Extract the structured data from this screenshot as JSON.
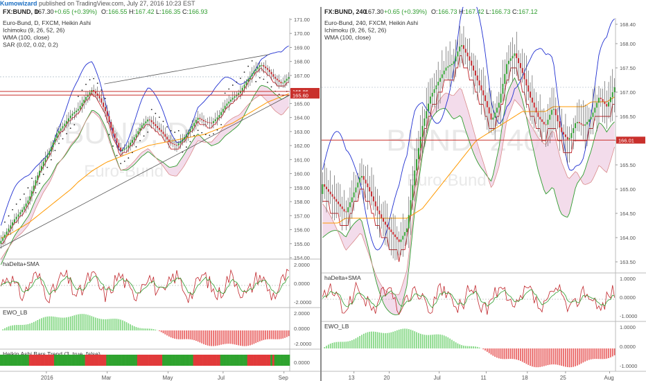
{
  "header": {
    "brand": "Kumowizard",
    "text": "published on TradingView.com, July 27, 2016 10:23 EST"
  },
  "colors": {
    "up": "#2e9c2e",
    "down": "#c0262b",
    "wma": "#ff9900",
    "tenkan": "#1f2fd1",
    "kijun": "#c0262b",
    "senkouA": "#2e9c2e",
    "cloud": "#f0d3e6",
    "trend": "#6a8f6a",
    "priceLine": "#c9302c",
    "ewoUp": "#7fd67f",
    "ewoDown": "#e85c5c",
    "sar": "#222222"
  },
  "charts": [
    {
      "id": "daily",
      "legend": {
        "symbol": "FX:BUND, D",
        "last": "167.30",
        "change": "+0.65 (+0.39%)",
        "o_label": "O:",
        "o": "166.55",
        "h_label": "H:",
        "h": "167.42",
        "l_label": "L:",
        "l": "166.35",
        "c_label": "C:",
        "c": "166.93"
      },
      "indicators": [
        "Euro-Bund, D, FXCM, Heikin Ashi",
        "Ichimoku (9, 26, 52, 26)",
        "WMA (100, close)",
        "SAR (0.02, 0.02, 0.2)"
      ],
      "watermark": {
        "big": "BUND, D",
        "small": "Euro-Bund"
      },
      "yTicks": [
        "171.00",
        "170.00",
        "169.00",
        "168.00",
        "167.00",
        "166.00",
        "165.00",
        "164.00",
        "163.00",
        "162.00",
        "161.00",
        "160.00",
        "159.00",
        "158.00",
        "157.00",
        "156.00",
        "155.00",
        "154.00"
      ],
      "yRange": [
        154,
        171
      ],
      "priceTags": [
        {
          "value": "165.86",
          "y": 165.86
        },
        {
          "value": "165.60",
          "y": 165.6
        }
      ],
      "xTicks": [
        {
          "label": "2016",
          "pos": 0.16
        },
        {
          "label": "Mar",
          "pos": 0.37
        },
        {
          "label": "May",
          "pos": 0.58
        },
        {
          "label": "Jul",
          "pos": 0.77
        },
        {
          "label": "Sep",
          "pos": 0.98
        }
      ],
      "sub": [
        {
          "title": "haDelta+SMA",
          "ticks": [
            "2.0000",
            "0.0000",
            "-2.0000"
          ]
        },
        {
          "title": "EWO_LB",
          "ticks": [
            "2.0000",
            "0.0000",
            "-2.0000"
          ]
        },
        {
          "title": "Heikin Ashi Bars Trend (3, true, false)",
          "ticks": [
            "0.0000"
          ]
        }
      ]
    },
    {
      "id": "h4",
      "legend": {
        "symbol": "FX:BUND, 240",
        "last": "167.30",
        "change": "+0.65 (+0.39%)",
        "o_label": "O:",
        "o": "166.73",
        "h_label": "H:",
        "h": "167.42",
        "l_label": "L:",
        "l": "166.73",
        "c_label": "C:",
        "c": "167.12"
      },
      "indicators": [
        "Euro-Bund, 240, FXCM, Heikin Ashi",
        "Ichimoku (9, 26, 52, 26)",
        "WMA (100, close)"
      ],
      "watermark": {
        "big": "BUND, 240",
        "small": "Euro-Bund"
      },
      "yTicks": [
        "168.40",
        "168.00",
        "167.50",
        "167.00",
        "166.50",
        "166.00",
        "165.50",
        "165.00",
        "164.50",
        "164.00",
        "163.50"
      ],
      "yRange": [
        163.3,
        168.5
      ],
      "priceTags": [
        {
          "value": "166.01",
          "y": 166.01
        }
      ],
      "xTicks": [
        {
          "label": "13",
          "pos": 0.11
        },
        {
          "label": "20",
          "pos": 0.23
        },
        {
          "label": "Jul",
          "pos": 0.4
        },
        {
          "label": "11",
          "pos": 0.56
        },
        {
          "label": "18",
          "pos": 0.7
        },
        {
          "label": "25",
          "pos": 0.83
        },
        {
          "label": "Aug",
          "pos": 0.98
        }
      ],
      "sub": [
        {
          "title": "haDelta+SMA",
          "ticks": [
            "1.0000",
            "0.0000",
            "-1.0000"
          ]
        },
        {
          "title": "EWO_LB",
          "ticks": [
            "1.0000",
            "0.0000",
            "-1.0000"
          ]
        }
      ]
    }
  ],
  "chart_data": [
    {
      "type": "candlestick",
      "title": "Euro-Bund, D, FXCM, Heikin Ashi",
      "ylim": [
        154,
        171
      ],
      "series": [
        {
          "name": "Euro-Bund",
          "values": [
            155.2,
            156.0,
            156.8,
            157.4,
            158.2,
            159.6,
            160.8,
            161.7,
            162.9,
            163.5,
            164.2,
            164.6,
            165.4,
            166.0,
            165.4,
            164.3,
            162.8,
            161.6,
            161.9,
            162.6,
            163.4,
            163.9,
            163.4,
            162.9,
            162.2,
            162.0,
            162.5,
            163.2,
            164.0,
            163.7,
            163.6,
            164.1,
            164.9,
            165.4,
            165.8,
            166.6,
            167.3,
            167.8,
            167.4,
            166.8,
            166.4,
            166.9
          ]
        },
        {
          "name": "WMA (100, close)",
          "values": [
            155.4,
            155.6,
            155.9,
            156.2,
            156.5,
            156.9,
            157.3,
            157.7,
            158.1,
            158.5,
            158.9,
            159.4,
            159.8,
            160.2,
            160.5,
            160.8,
            161.0,
            161.2,
            161.4,
            161.6,
            161.8,
            162.0,
            162.1,
            162.2,
            162.3,
            162.4,
            162.5,
            162.6,
            162.7,
            162.8,
            163.0,
            163.2,
            163.4,
            163.6,
            163.9,
            164.2,
            164.5,
            164.8,
            165.1,
            165.3,
            165.5,
            165.7
          ]
        }
      ],
      "trendlines": [
        {
          "from": [
            0.0,
            154.7
          ],
          "to": [
            1.0,
            165.6
          ]
        },
        {
          "from": [
            0.36,
            166.4
          ],
          "to": [
            0.93,
            168.5
          ]
        }
      ],
      "price_lines": [
        165.86,
        165.6
      ]
    },
    {
      "type": "candlestick",
      "title": "Euro-Bund, 240, FXCM, Heikin Ashi",
      "ylim": [
        163.3,
        168.5
      ],
      "series": [
        {
          "name": "Euro-Bund",
          "values": [
            165.1,
            164.9,
            164.7,
            164.5,
            164.9,
            165.3,
            165.0,
            164.6,
            164.3,
            164.1,
            163.9,
            164.2,
            165.4,
            166.3,
            166.9,
            167.2,
            167.5,
            167.6,
            168.0,
            167.7,
            167.3,
            166.9,
            166.4,
            166.8,
            167.6,
            167.8,
            167.4,
            166.9,
            166.5,
            166.3,
            166.7,
            166.2,
            166.0,
            166.4,
            166.3,
            166.5,
            166.9,
            166.7,
            167.1
          ]
        },
        {
          "name": "WMA (100, close)",
          "values": [
            164.3,
            164.3,
            164.3,
            164.4,
            164.4,
            164.4,
            164.4,
            164.4,
            164.4,
            164.4,
            164.4,
            164.4,
            164.5,
            164.6,
            164.8,
            165.0,
            165.2,
            165.4,
            165.6,
            165.8,
            166.0,
            166.1,
            166.2,
            166.3,
            166.4,
            166.5,
            166.6,
            166.6,
            166.6,
            166.6,
            166.7,
            166.7,
            166.7,
            166.7,
            166.7,
            166.8,
            166.8,
            166.8,
            166.9
          ]
        }
      ],
      "price_lines": [
        166.01
      ]
    }
  ]
}
